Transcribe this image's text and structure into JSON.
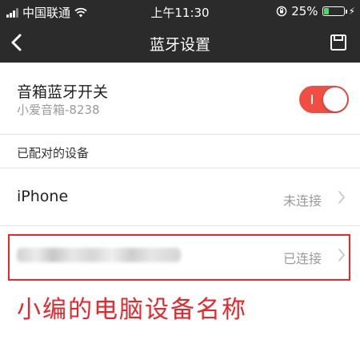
{
  "status_bar": {
    "carrier": "中国联通",
    "time": "上午11:30",
    "battery_percent": "25%",
    "battery_level": 0.25
  },
  "nav": {
    "title": "蓝牙设置"
  },
  "speaker": {
    "title": "音箱蓝牙开关",
    "subtitle": "小爱音箱-8238",
    "toggle_on": true
  },
  "paired_section": {
    "label": "已配对的设备"
  },
  "devices": [
    {
      "name": "iPhone",
      "status": "未连接"
    },
    {
      "name": "",
      "status": "已连接"
    }
  ],
  "annotation": {
    "text": "小编的电脑设备名称"
  },
  "colors": {
    "bar_background": "#2b2b2b",
    "toggle_on": "#f04e42",
    "annotation_red": "#e8262b"
  }
}
